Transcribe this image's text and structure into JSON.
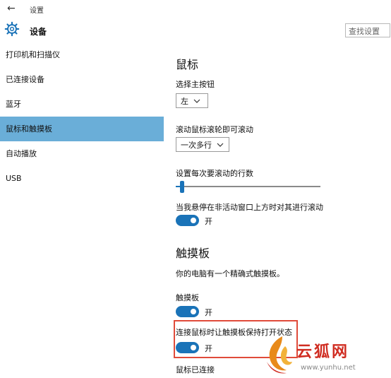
{
  "titlebar": {
    "back_glyph": "←",
    "title": "设置"
  },
  "header": {
    "title": "设备",
    "search_placeholder": "查找设置"
  },
  "sidebar": {
    "items": [
      {
        "label": "打印机和扫描仪"
      },
      {
        "label": "已连接设备"
      },
      {
        "label": "蓝牙"
      },
      {
        "label": "鼠标和触摸板",
        "active": true
      },
      {
        "label": "自动播放"
      },
      {
        "label": "USB"
      }
    ]
  },
  "mouse": {
    "heading": "鼠标",
    "primary_button_label": "选择主按钮",
    "primary_button_value": "左",
    "wheel_label": "滚动鼠标滚轮即可滚动",
    "wheel_value": "一次多行",
    "lines_label": "设置每次要滚动的行数",
    "lines_slider_fraction": 0.03,
    "inactive_scroll_label": "当我悬停在非活动窗口上方时对其进行滚动",
    "inactive_scroll_state": "开"
  },
  "touchpad": {
    "heading": "触摸板",
    "description": "你的电脑有一个精确式触摸板。",
    "touchpad_label": "触摸板",
    "touchpad_state": "开",
    "keep_on_label": "连接鼠标时让触摸板保持打开状态",
    "keep_on_state": "开",
    "mouse_connected_label": "鼠标已连接"
  },
  "watermark": {
    "brand": "云狐网",
    "url": "www.yunhu.net"
  },
  "colors": {
    "accent": "#1a73b8",
    "nav_active": "#6aaed8",
    "highlight": "#e04b3a",
    "watermark": "#d02d22"
  }
}
